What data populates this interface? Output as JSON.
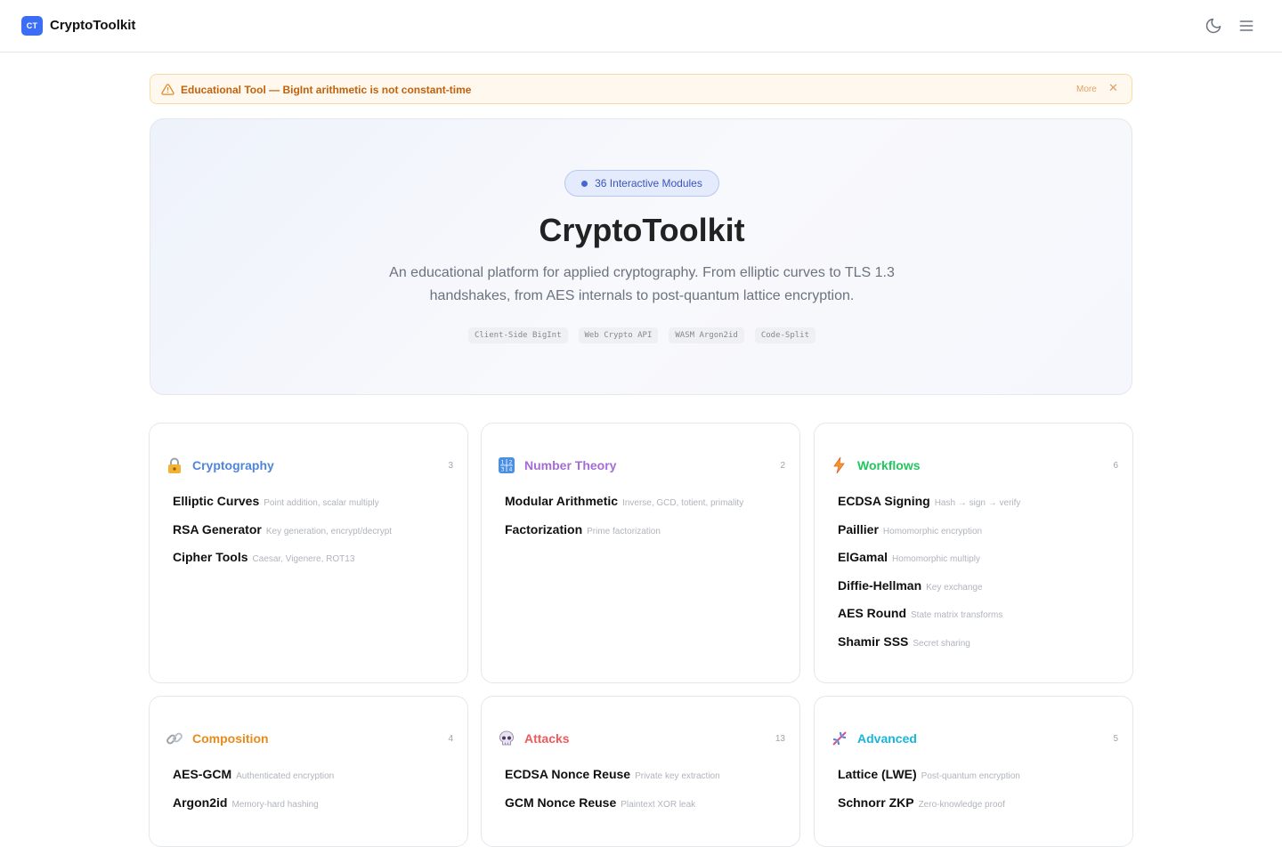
{
  "app": {
    "badge": "CT",
    "name": "CryptoToolkit"
  },
  "topbar": {
    "theme_icon": "moon-icon",
    "menu_icon": "hamburger-menu-icon"
  },
  "banner": {
    "text": "Educational Tool — BigInt arithmetic is not constant-time",
    "more": "More",
    "close": "✕"
  },
  "hero": {
    "pill": "36 Interactive Modules",
    "title": "CryptoToolkit",
    "desc_line1": "An educational platform for applied cryptography. From elliptic curves to TLS 1.3",
    "desc_line2": "handshakes, from AES internals to post-quantum lattice encryption.",
    "tags": [
      "Client-Side BigInt",
      "Web Crypto API",
      "WASM Argon2id",
      "Code-Split"
    ]
  },
  "colors": {
    "cryptography": "#4f86d9",
    "number_theory": "#a56cd8",
    "workflows": "#22c55e",
    "composition": "#ea8a1a",
    "attacks": "#ef5a5a",
    "advanced": "#18b6d8"
  },
  "categories": [
    {
      "title": "Cryptography",
      "count": "3",
      "icon": "lock-icon",
      "items": [
        {
          "name": "Elliptic Curves",
          "desc": "Point addition, scalar multiply"
        },
        {
          "name": "RSA Generator",
          "desc": "Key generation, encrypt/decrypt"
        },
        {
          "name": "Cipher Tools",
          "desc": "Caesar, Vigenere, ROT13"
        }
      ]
    },
    {
      "title": "Number Theory",
      "count": "2",
      "icon": "numbers-icon",
      "items": [
        {
          "name": "Modular Arithmetic",
          "desc": "Inverse, GCD, totient, primality"
        },
        {
          "name": "Factorization",
          "desc": "Prime factorization"
        }
      ]
    },
    {
      "title": "Workflows",
      "count": "6",
      "icon": "lightning-icon",
      "items": [
        {
          "name": "ECDSA Signing",
          "desc": "Hash → sign → verify"
        },
        {
          "name": "Paillier",
          "desc": "Homomorphic encryption"
        },
        {
          "name": "ElGamal",
          "desc": "Homomorphic multiply"
        },
        {
          "name": "Diffie-Hellman",
          "desc": "Key exchange"
        },
        {
          "name": "AES Round",
          "desc": "State matrix transforms"
        },
        {
          "name": "Shamir SSS",
          "desc": "Secret sharing"
        }
      ]
    },
    {
      "title": "Composition",
      "count": "4",
      "icon": "link-icon",
      "items": [
        {
          "name": "AES-GCM",
          "desc": "Authenticated encryption"
        },
        {
          "name": "Argon2id",
          "desc": "Memory-hard hashing"
        }
      ]
    },
    {
      "title": "Attacks",
      "count": "13",
      "icon": "skull-icon",
      "items": [
        {
          "name": "ECDSA Nonce Reuse",
          "desc": "Private key extraction"
        },
        {
          "name": "GCM Nonce Reuse",
          "desc": "Plaintext XOR leak"
        }
      ]
    },
    {
      "title": "Advanced",
      "count": "5",
      "icon": "dna-icon",
      "items": [
        {
          "name": "Lattice (LWE)",
          "desc": "Post-quantum encryption"
        },
        {
          "name": "Schnorr ZKP",
          "desc": "Zero-knowledge proof"
        }
      ]
    }
  ]
}
